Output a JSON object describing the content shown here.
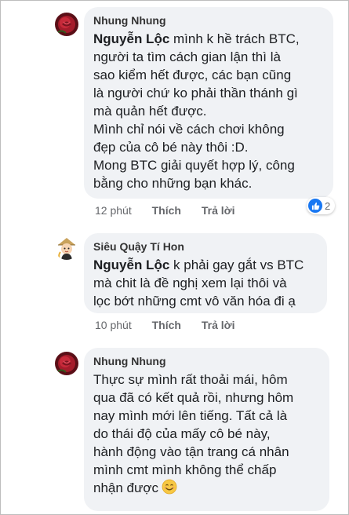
{
  "comments": [
    {
      "author": "Nhung Nhung",
      "mention": "Nguyễn Lộc",
      "lines": [
        " mình k hề trách BTC,",
        "người ta tìm cách gian lận thì là",
        "sao kiểm hết được, các bạn cũng",
        "là người chứ ko phải thần thánh gì",
        "mà quản hết được.",
        "Mình chỉ nói về cách chơi không",
        "đẹp của cô bé này thôi :D.",
        "Mong BTC giải quyết hợp lý, công",
        "bằng cho những bạn khác."
      ],
      "time": "12 phút",
      "like_label": "Thích",
      "reply_label": "Trả lời",
      "reaction_count": "2",
      "reaction_icon": "thumbs-up-icon",
      "avatar_icon": "rose-avatar-icon"
    },
    {
      "author": "Siêu Quậy Tí Hon",
      "mention": "Nguyễn Lộc",
      "lines": [
        " k phải gay gắt vs BTC",
        "mà chit là đề nghị xem lại thôi và",
        "lọc bớt những cmt vô văn hóa đi ạ"
      ],
      "time": "10 phút",
      "like_label": "Thích",
      "reply_label": "Trả lời",
      "avatar_icon": "cartoon-avatar-icon"
    },
    {
      "author": "Nhung Nhung",
      "lines": [
        "Thực sự mình rất thoải mái, hôm",
        "qua đã có kết quả rồi, nhưng hôm",
        "nay mình mới lên tiếng. Tất cả là",
        "do thái độ của mấy cô bé này,",
        "hành động vào tận trang cá nhân",
        "mình cmt mình không thể chấp",
        "nhận được"
      ],
      "emoji": "smiling-face-emoji",
      "avatar_icon": "rose-avatar-icon"
    }
  ],
  "colors": {
    "bubble": "#f0f2f5",
    "reaction_blue": "#1877f2",
    "meta_text": "#65676b"
  }
}
